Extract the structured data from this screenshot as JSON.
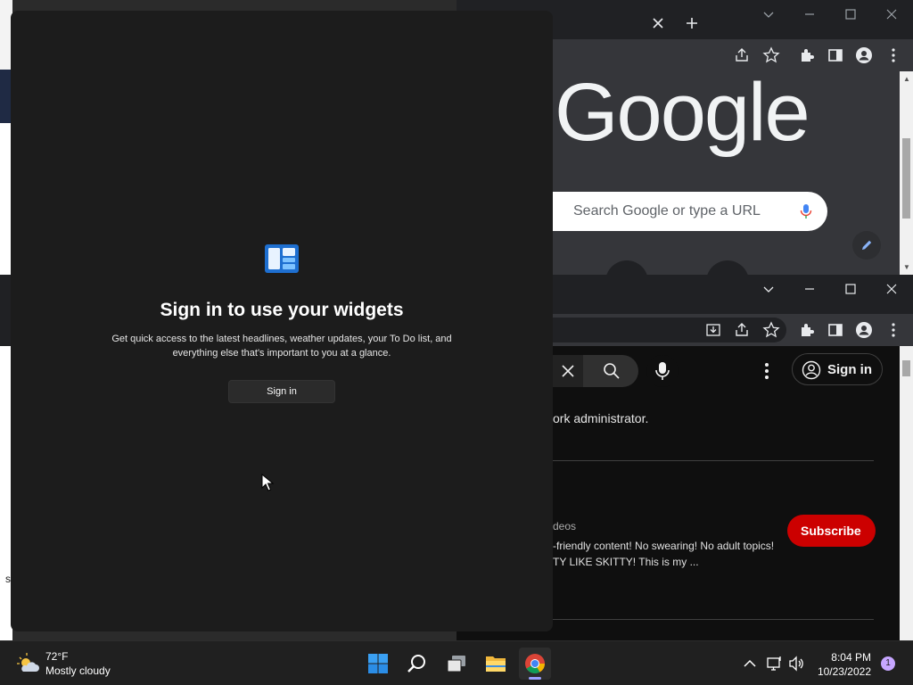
{
  "chrome_top": {
    "omnibox_text": "Search Google or type a...",
    "logo_text": "Google",
    "search_box_placeholder": "Search Google or type a URL"
  },
  "youtube": {
    "sign_in_label": "Sign in",
    "notice_text": "ork administrator.",
    "videos_label": "deos",
    "desc_line1": "-friendly content! No swearing! No adult topics!",
    "desc_line2": "TY LIKE SKITTY! This is my ...",
    "subscribe_label": "Subscribe"
  },
  "widgets_panel": {
    "title": "Sign in to use your widgets",
    "description": "Get quick access to the latest headlines, weather updates, your To Do list, and everything else that's important to you at a glance.",
    "sign_in_button": "Sign in"
  },
  "left_edge_char": "s",
  "taskbar": {
    "weather_temp": "72°F",
    "weather_condition": "Mostly cloudy",
    "time": "8:04 PM",
    "date": "10/23/2022",
    "notification_count": "1",
    "apps": [
      "start-icon",
      "search-icon",
      "task-view-icon",
      "file-explorer-icon",
      "chrome-icon"
    ]
  },
  "colors": {
    "subscribe_red": "#cc0000",
    "panel_bg": "#1c1c1c",
    "taskbar_bg": "#202020"
  }
}
